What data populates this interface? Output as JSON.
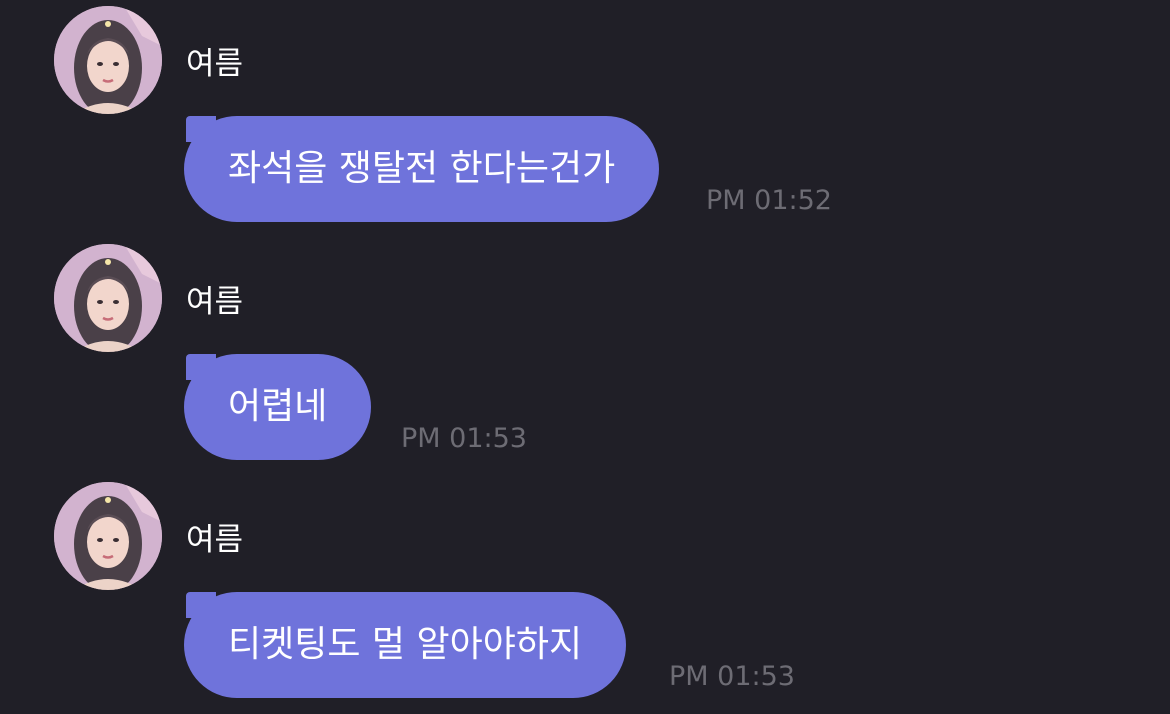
{
  "messages": [
    {
      "sender": "여름",
      "text": "좌석을 쟁탈전 한다는건가",
      "time": "PM 01:52"
    },
    {
      "sender": "여름",
      "text": "어렵네",
      "time": "PM 01:53"
    },
    {
      "sender": "여름",
      "text": "티켓팅도 멀 알아야하지",
      "time": "PM 01:53"
    }
  ],
  "colors": {
    "background": "#201f27",
    "bubble": "#6f73db",
    "timestamp": "#6d6c74"
  }
}
